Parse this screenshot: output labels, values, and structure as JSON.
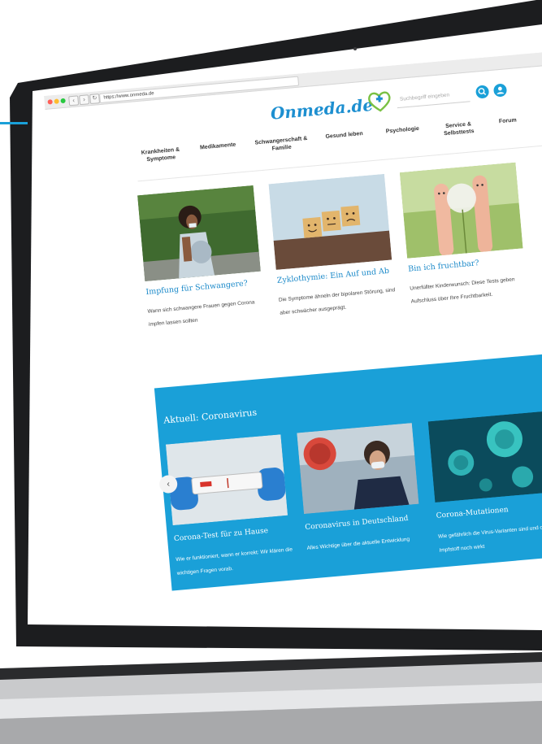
{
  "browser": {
    "url": "https://www.onmeda.de"
  },
  "header": {
    "logo": "Onmeda.de",
    "search_placeholder": "Suchbegriff eingeben"
  },
  "menu": [
    "Krankheiten &\nSymptome",
    "Medikamente",
    "Schwangerschaft &\nFamilie",
    "Gesund leben",
    "Psychologie",
    "Service &\nSelbsttests",
    "Forum"
  ],
  "articles": [
    {
      "title": "Impfung für Schwangere?",
      "text": "Wann sich schwangere Frauen gegen Corona impfen lassen sollten"
    },
    {
      "title": "Zyklothymie: Ein Auf und Ab",
      "text": "Die Symptome ähneln der bipolaren Störung, sind aber schwächer ausgeprägt."
    },
    {
      "title": "Bin ich fruchtbar?",
      "text": "Unerfüllter Kinderwunsch: Diese Tests geben Aufschluss über Ihre Fruchtbarkeit."
    }
  ],
  "corona": {
    "heading": "Aktuell: Coronavirus",
    "prev": "‹",
    "next": "›",
    "cards": [
      {
        "title": "Corona-Test für zu Hause",
        "text": "Wie er funktioniert, wann er korrekt: Wir klären die wichtigen Fragen vorab."
      },
      {
        "title": "Coronavirus in Deutschland",
        "text": "Alles Wichtige über die aktuelle Entwicklung"
      },
      {
        "title": "Corona-Mutationen",
        "text": "Wie gefährlich die Virus-Varianten sind und ob der Impfstoff noch wirkt"
      }
    ]
  },
  "colors": {
    "accent": "#1aa0d8",
    "link": "#1a89c9",
    "bezel": "#1c1d1f"
  }
}
